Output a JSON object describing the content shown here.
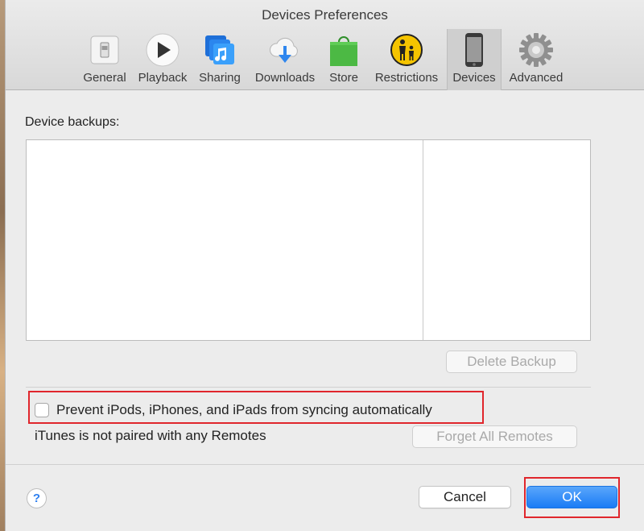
{
  "window": {
    "title": "Devices Preferences"
  },
  "toolbar": {
    "tabs": [
      {
        "label": "General",
        "icon": "switch-icon"
      },
      {
        "label": "Playback",
        "icon": "play-icon"
      },
      {
        "label": "Sharing",
        "icon": "music-library-icon"
      },
      {
        "label": "Downloads",
        "icon": "cloud-download-icon"
      },
      {
        "label": "Store",
        "icon": "shopping-bag-icon"
      },
      {
        "label": "Restrictions",
        "icon": "parental-controls-icon"
      },
      {
        "label": "Devices",
        "icon": "iphone-icon",
        "selected": true
      },
      {
        "label": "Advanced",
        "icon": "gear-icon"
      }
    ]
  },
  "devices": {
    "backups_label": "Device backups:",
    "delete_backup_label": "Delete Backup",
    "prevent_sync_label": "Prevent iPods, iPhones, and iPads from syncing automatically",
    "prevent_sync_checked": false,
    "remotes_status": "iTunes is not paired with any Remotes",
    "forget_remotes_label": "Forget All Remotes"
  },
  "footer": {
    "help_label": "?",
    "cancel_label": "Cancel",
    "ok_label": "OK"
  },
  "colors": {
    "accent_blue": "#1a7cf5",
    "highlight_red": "#e0262c",
    "store_green": "#4cb944",
    "restrictions_yellow": "#f5c400"
  }
}
